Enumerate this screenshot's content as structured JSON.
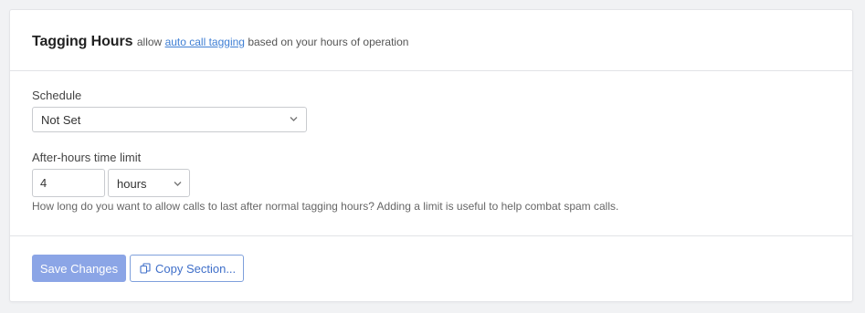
{
  "header": {
    "title": "Tagging Hours",
    "subtitle_before": "allow",
    "subtitle_link": "auto call tagging",
    "subtitle_after": "based on your hours of operation"
  },
  "schedule": {
    "label": "Schedule",
    "selected": "Not Set"
  },
  "after_hours": {
    "label": "After-hours time limit",
    "value": "4",
    "unit_selected": "hours",
    "help": "How long do you want to allow calls to last after normal tagging hours? Adding a limit is useful to help combat spam calls."
  },
  "footer": {
    "save_label": "Save Changes",
    "copy_label": "Copy Section..."
  },
  "icons": {
    "select": "chevron-down-icon",
    "copy": "copy-icon"
  },
  "colors": {
    "link": "#3f7fd4",
    "primary_button": "#8ba5e6",
    "secondary_button_text": "#3f6fc9"
  }
}
